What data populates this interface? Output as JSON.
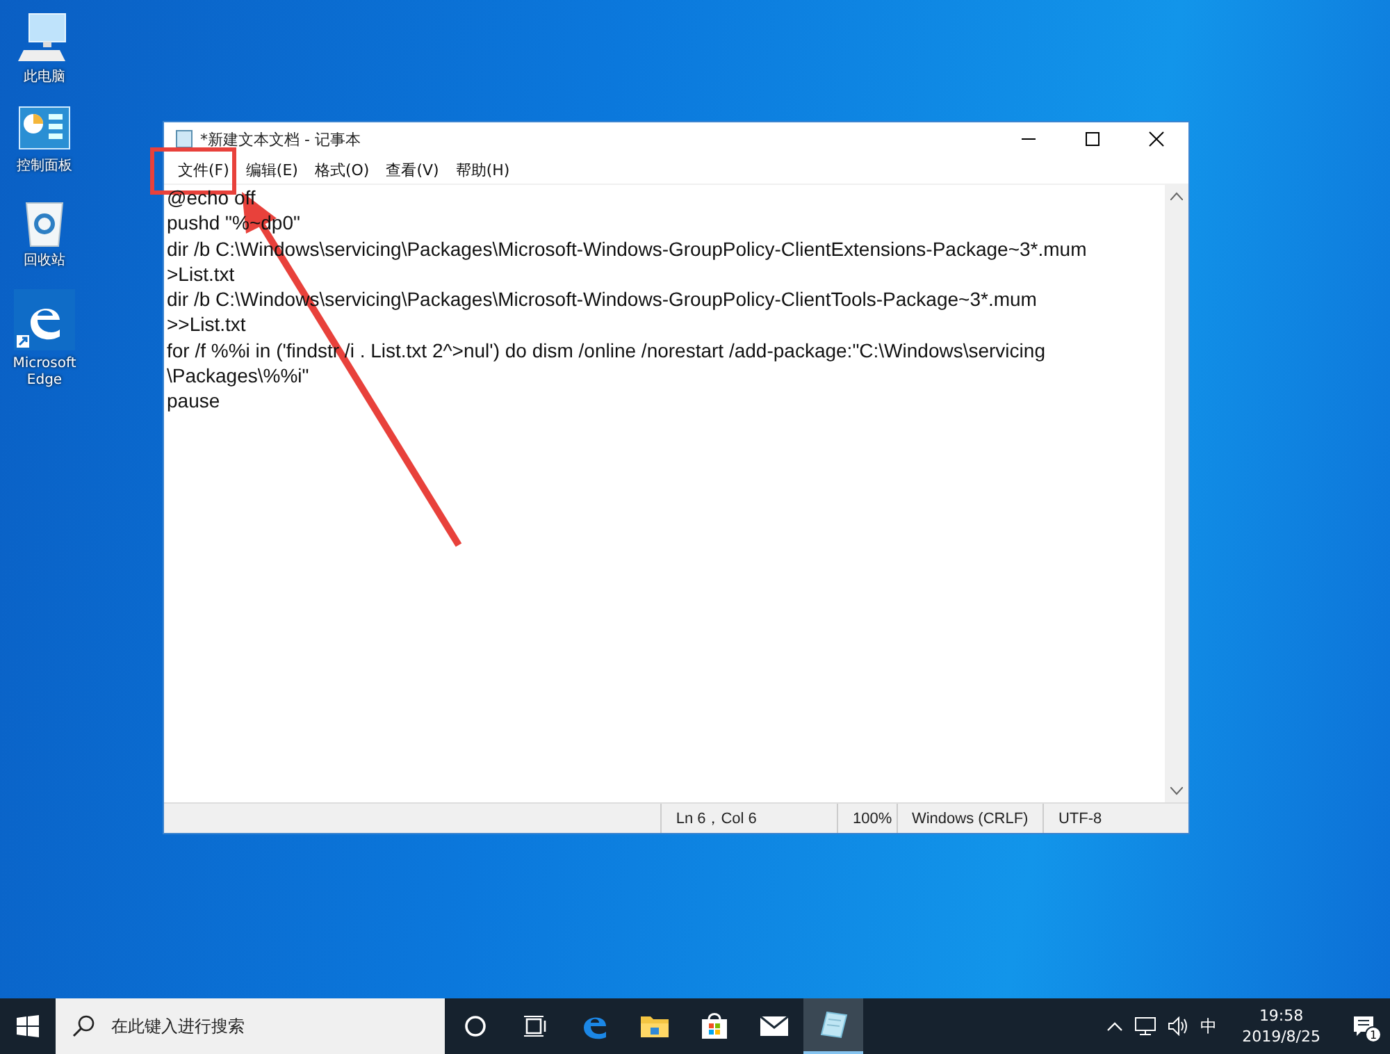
{
  "desktop_icons": [
    {
      "kind": "computer",
      "label": "此电脑"
    },
    {
      "kind": "control-panel",
      "label": "控制面板"
    },
    {
      "kind": "recycle-bin",
      "label": "回收站"
    },
    {
      "kind": "edge",
      "label": "Microsoft Edge"
    }
  ],
  "window": {
    "title": "*新建文本文档 - 记事本",
    "menu": [
      "文件(F)",
      "编辑(E)",
      "格式(O)",
      "查看(V)",
      "帮助(H)"
    ],
    "lines": [
      "@echo off",
      "pushd \"%~dp0\"",
      "dir /b C:\\Windows\\servicing\\Packages\\Microsoft-Windows-GroupPolicy-ClientExtensions-Package~3*.mum",
      ">List.txt",
      "dir /b C:\\Windows\\servicing\\Packages\\Microsoft-Windows-GroupPolicy-ClientTools-Package~3*.mum",
      ">>List.txt",
      "for /f %%i in ('findstr /i . List.txt 2^>nul') do dism /online /norestart /add-package:\"C:\\Windows\\servicing",
      "\\Packages\\%%i\"",
      "pause"
    ],
    "status_bar": [
      "Ln 6，Col 6",
      "100%",
      "Windows (CRLF)",
      "UTF-8"
    ]
  },
  "taskbar": {
    "search": {
      "placeholder": "在此键入进行搜索"
    },
    "apps": [
      {
        "kind": "cortana",
        "selected": false
      },
      {
        "kind": "task-view",
        "selected": false
      },
      {
        "kind": "edge",
        "selected": false
      },
      {
        "kind": "explorer",
        "selected": false
      },
      {
        "kind": "store",
        "selected": false
      },
      {
        "kind": "mail",
        "selected": false
      },
      {
        "kind": "notepad",
        "selected": true
      }
    ],
    "ime": "中",
    "time": "19:58",
    "date": "2019/8/25",
    "notifications": "1"
  }
}
